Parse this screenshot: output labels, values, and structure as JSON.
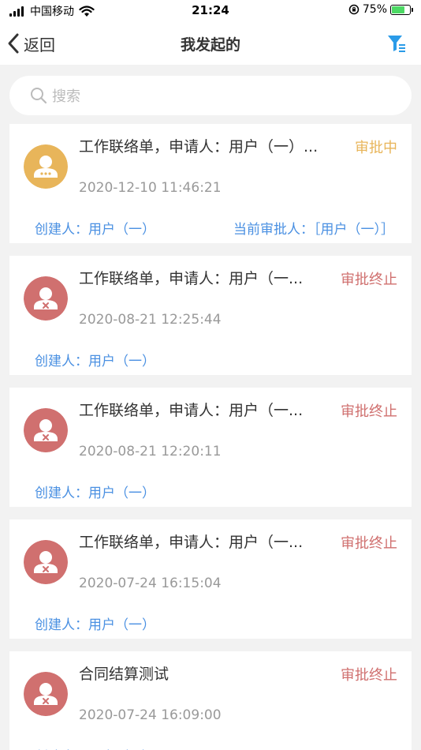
{
  "status_bar": {
    "carrier": "中国移动",
    "time": "21:24",
    "battery": "75%",
    "battery_level": 0.75
  },
  "nav": {
    "back_label": "返回",
    "title": "我发起的"
  },
  "search": {
    "placeholder": "搜索"
  },
  "colors": {
    "pending": "#e8b55a",
    "terminated": "#d0706f",
    "link": "#4a90e2",
    "filter": "#2a9be8"
  },
  "list": {
    "items": [
      {
        "title": "工作联络单，申请人：用户（一）...",
        "status": "审批中",
        "status_type": "pending",
        "date": "2020-12-10 11:46:21",
        "creator": "创建人：用户（一）",
        "approver": "当前审批人：［用户（一）］"
      },
      {
        "title": "工作联络单，申请人：用户（一...",
        "status": "审批终止",
        "status_type": "terminated",
        "date": "2020-08-21 12:25:44",
        "creator": "创建人：用户（一）",
        "approver": ""
      },
      {
        "title": "工作联络单，申请人：用户（一...",
        "status": "审批终止",
        "status_type": "terminated",
        "date": "2020-08-21 12:20:11",
        "creator": "创建人：用户（一）",
        "approver": ""
      },
      {
        "title": "工作联络单，申请人：用户（一...",
        "status": "审批终止",
        "status_type": "terminated",
        "date": "2020-07-24 16:15:04",
        "creator": "创建人：用户（一）",
        "approver": ""
      },
      {
        "title": "合同结算测试",
        "status": "审批终止",
        "status_type": "terminated",
        "date": "2020-07-24 16:09:00",
        "creator": "创建人：用户（一）",
        "approver": ""
      }
    ]
  }
}
